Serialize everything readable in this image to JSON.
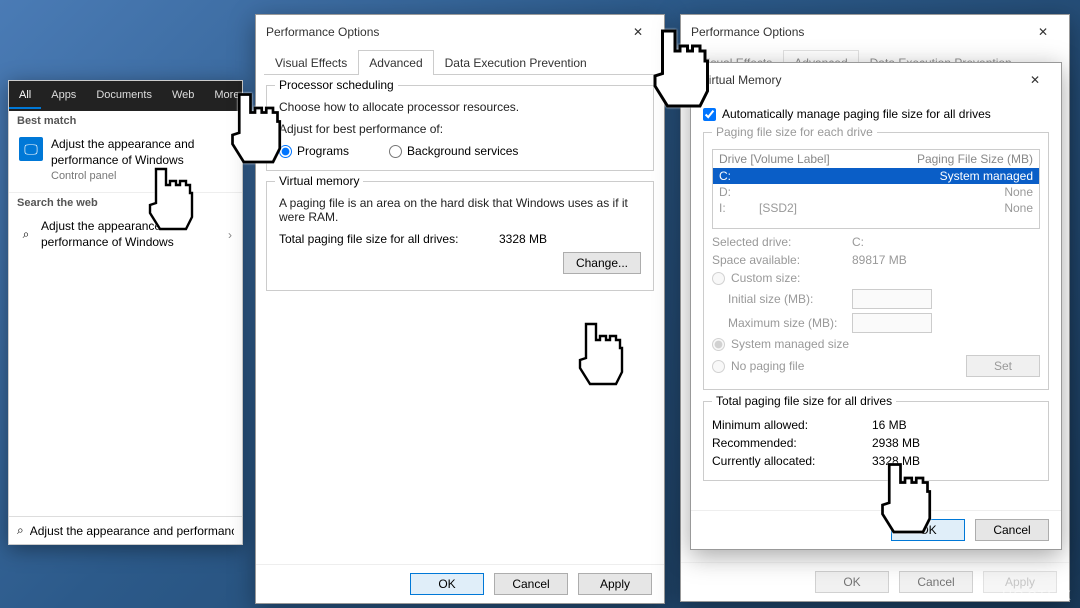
{
  "startmenu": {
    "tabs": [
      "All",
      "Apps",
      "Documents",
      "Web",
      "More"
    ],
    "section_bestmatch": "Best match",
    "result_title": "Adjust the appearance and performance of Windows",
    "result_sub": "Control panel",
    "section_web": "Search the web",
    "web_item": "Adjust the appearance and performance of Windows",
    "chevron": "›",
    "search_label": "Adjust the appearance and performance of Windows"
  },
  "perf1": {
    "title": "Performance Options",
    "tabs": {
      "ve": "Visual Effects",
      "adv": "Advanced",
      "dep": "Data Execution Prevention"
    },
    "proc": {
      "legend": "Processor scheduling",
      "desc": "Choose how to allocate processor resources.",
      "subdesc": "Adjust for best performance of:",
      "opt_programs": "Programs",
      "opt_bg": "Background services"
    },
    "vm": {
      "legend": "Virtual memory",
      "desc": "A paging file is an area on the hard disk that Windows uses as if it were RAM.",
      "total_label": "Total paging file size for all drives:",
      "total_value": "3328 MB",
      "change": "Change..."
    },
    "footer": {
      "ok": "OK",
      "cancel": "Cancel",
      "apply": "Apply"
    }
  },
  "perf2": {
    "title": "Performance Options",
    "tabs": {
      "ve": "Visual Effects",
      "adv": "Advanced",
      "dep": "Data Execution Prevention"
    }
  },
  "vmdlg": {
    "title": "Virtual Memory",
    "auto": "Automatically manage paging file size for all drives",
    "group_legend": "Paging file size for each drive",
    "hdr_drive": "Drive  [Volume Label]",
    "hdr_size": "Paging File Size (MB)",
    "drives": [
      {
        "letter": "C:",
        "label": "",
        "size": "System managed",
        "sel": true
      },
      {
        "letter": "D:",
        "label": "",
        "size": "None",
        "sel": false
      },
      {
        "letter": "I:",
        "label": "[SSD2]",
        "size": "None",
        "sel": false
      }
    ],
    "seldrive_lbl": "Selected drive:",
    "seldrive_val": "C:",
    "space_lbl": "Space available:",
    "space_val": "89817 MB",
    "custom": "Custom size:",
    "initial": "Initial size (MB):",
    "max": "Maximum size (MB):",
    "sys": "System managed size",
    "none": "No paging file",
    "set": "Set",
    "totals_legend": "Total paging file size for all drives",
    "min_lbl": "Minimum allowed:",
    "min_val": "16 MB",
    "rec_lbl": "Recommended:",
    "rec_val": "2938 MB",
    "cur_lbl": "Currently allocated:",
    "cur_val": "3328 MB",
    "ok": "OK",
    "cancel": "Cancel"
  }
}
